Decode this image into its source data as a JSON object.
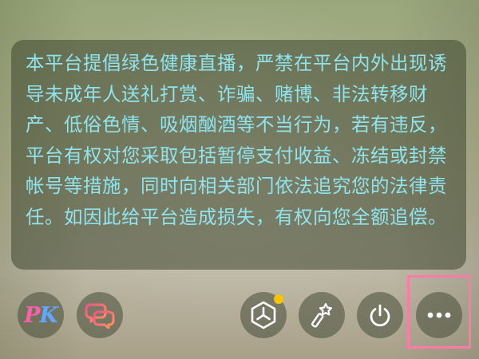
{
  "notice": {
    "text": "本平台提倡绿色健康直播，严禁在平台内外出现诱导未成年人送礼打赏、诈骗、赌博、非法转移财产、低俗色情、吸烟酗酒等不当行为，若有违反，平台有权对您采取包括暂停支付收益、冻结或封禁帐号等措施，同时向相关部门依法追究您的法律责任。如因此给平台造成损失，有权向您全额追偿。",
    "text_color": "#8fe4ee"
  },
  "toolbar": {
    "pk": {
      "letter_p": "P",
      "letter_k": "K",
      "icon": "pk-icon"
    },
    "link": {
      "icon": "chat-link-icon"
    },
    "tools": {
      "icon": "hexagon-menu-icon",
      "badge_color": "#f7c400"
    },
    "beauty": {
      "icon": "magic-wand-icon"
    },
    "power": {
      "icon": "power-icon"
    },
    "more": {
      "icon": "more-dots-icon",
      "highlight_color": "#ff7aa8"
    }
  }
}
